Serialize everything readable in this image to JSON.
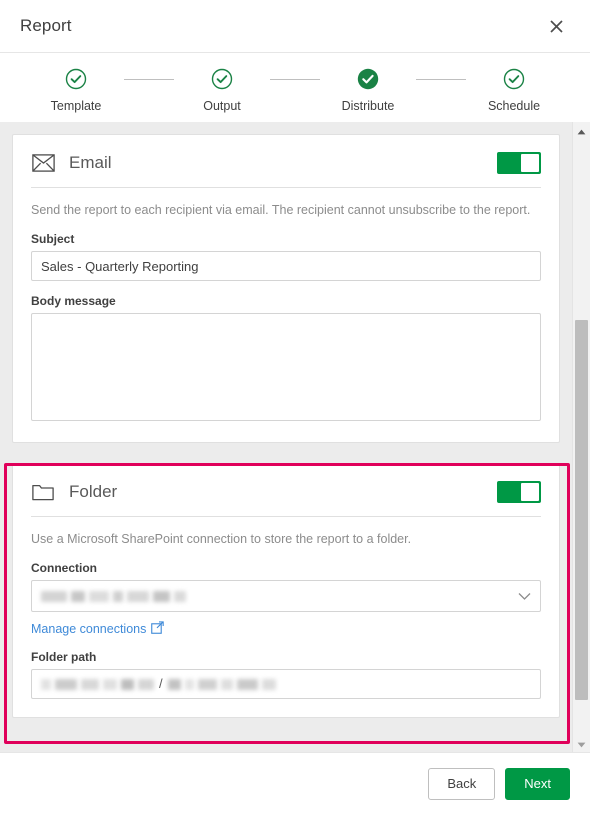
{
  "header": {
    "title": "Report",
    "close_icon": "close-icon"
  },
  "stepper": {
    "steps": [
      {
        "label": "Template",
        "state": "complete",
        "icon": "check-circle-outline-icon"
      },
      {
        "label": "Output",
        "state": "complete",
        "icon": "check-circle-outline-icon"
      },
      {
        "label": "Distribute",
        "state": "active",
        "icon": "check-circle-filled-icon"
      },
      {
        "label": "Schedule",
        "state": "complete",
        "icon": "check-circle-outline-icon"
      }
    ]
  },
  "cards": {
    "email": {
      "icon": "envelope-icon",
      "title": "Email",
      "toggle_state": "on",
      "description": "Send the report to each recipient via email. The recipient cannot unsubscribe to the report.",
      "subject": {
        "label": "Subject",
        "value": "Sales - Quarterly Reporting",
        "placeholder": ""
      },
      "body_message": {
        "label": "Body message",
        "value": "",
        "placeholder": ""
      }
    },
    "folder": {
      "icon": "folder-icon",
      "title": "Folder",
      "toggle_state": "on",
      "description": "Use a Microsoft SharePoint connection to store the report to a folder.",
      "connection": {
        "label": "Connection",
        "value": "",
        "redacted": true,
        "chevron_icon": "chevron-down-icon"
      },
      "manage_link": {
        "text": "Manage connections",
        "icon": "external-link-icon"
      },
      "folder_path": {
        "label": "Folder path",
        "value": "",
        "redacted": true,
        "separator": "/"
      }
    }
  },
  "footer": {
    "back_label": "Back",
    "next_label": "Next"
  },
  "scrollbar": {
    "up_icon": "triangle-up-icon",
    "down_icon": "triangle-down-icon"
  },
  "colors": {
    "accent_green": "#009845",
    "highlight_pink": "#e0005a",
    "link_blue": "#3f8ad8"
  }
}
